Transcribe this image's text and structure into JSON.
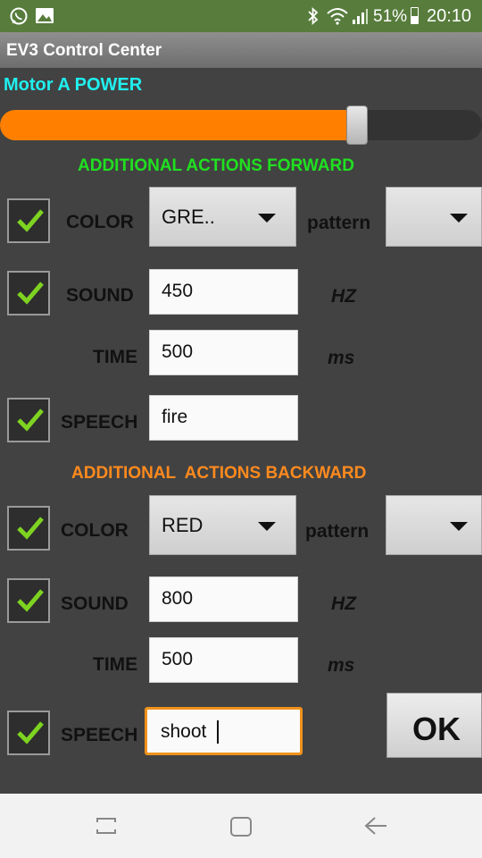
{
  "status": {
    "battery": "51%",
    "time": "20:10"
  },
  "app_title": "EV3 Control Center",
  "motor": {
    "label": "Motor A POWER",
    "power_fraction": 0.74
  },
  "colors": {
    "slider_fill": "#ff8000",
    "forward_title": "#20e020",
    "backward_title": "#ff8a1e",
    "motor_label": "#20f0f0",
    "check": "#7ed321"
  },
  "forward": {
    "title": "ADDITIONAL ACTIONS FORWARD",
    "color_label": "COLOR",
    "color_value": "GRE..",
    "pattern_label": "pattern",
    "pattern_value": "",
    "sound_label": "SOUND",
    "sound_value": "450",
    "sound_unit": "HZ",
    "time_label": "TIME",
    "time_value": "500",
    "time_unit": "ms",
    "speech_label": "SPEECH",
    "speech_value": "fire"
  },
  "backward": {
    "title": "ADDITIONAL  ACTIONS BACKWARD",
    "color_label": "COLOR",
    "color_value": "RED",
    "pattern_label": "pattern",
    "pattern_value": "",
    "sound_label": "SOUND",
    "sound_value": "800",
    "sound_unit": "HZ",
    "time_label": "TIME",
    "time_value": "500",
    "time_unit": "ms",
    "speech_label": "SPEECH",
    "speech_value": "shoot"
  },
  "ok_label": "OK",
  "icons": {
    "status_left": [
      "whatsapp-icon",
      "image-icon"
    ],
    "status_right": [
      "bluetooth-icon",
      "wifi-icon",
      "signal-icon"
    ],
    "nav": [
      "recents-icon",
      "home-icon",
      "back-icon"
    ]
  }
}
